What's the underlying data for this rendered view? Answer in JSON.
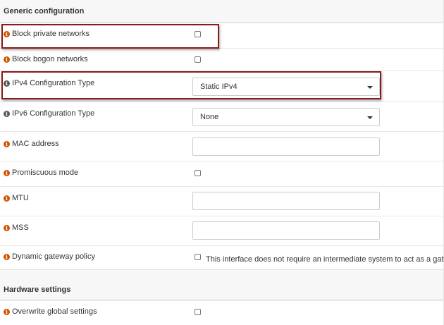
{
  "sections": {
    "generic": "Generic configuration",
    "hardware": "Hardware settings"
  },
  "fields": {
    "block_private": {
      "label": "Block private networks",
      "checked": false
    },
    "block_bogon": {
      "label": "Block bogon networks",
      "checked": false
    },
    "ipv4_type": {
      "label": "IPv4 Configuration Type",
      "value": "Static IPv4"
    },
    "ipv6_type": {
      "label": "IPv6 Configuration Type",
      "value": "None"
    },
    "mac_address": {
      "label": "MAC address",
      "value": ""
    },
    "promiscuous": {
      "label": "Promiscuous mode",
      "checked": false
    },
    "mtu": {
      "label": "MTU",
      "value": ""
    },
    "mss": {
      "label": "MSS",
      "value": ""
    },
    "dynamic_gateway": {
      "label": "Dynamic gateway policy",
      "checked": false,
      "note": "This interface does not require an intermediate system to act as a gateway"
    },
    "overwrite_global": {
      "label": "Overwrite global settings",
      "checked": false
    }
  },
  "icons": {
    "info": "i"
  },
  "colors": {
    "info_icon": "#d35400",
    "info_icon_alt": "#5a5a5a",
    "highlight_border": "#8b1a1a"
  }
}
